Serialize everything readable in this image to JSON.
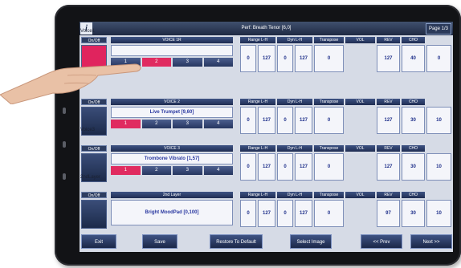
{
  "app": {
    "info_glyph": "i",
    "title": "Perf: Breath Tenor [6,0]",
    "page": "Page 1/3"
  },
  "param_headers": [
    "Range L-H",
    "Dyn L-H",
    "Transpose",
    "VOL",
    "REV",
    "CHO"
  ],
  "tab_labels": [
    "1",
    "2",
    "3",
    "4"
  ],
  "rows": [
    {
      "section_label": "Voice1",
      "onoff_label": "On/Off",
      "onoff_state": "on",
      "header": "VOICE 1R",
      "name": "",
      "has_tabs": true,
      "selected_tab": 2,
      "values": [
        "0",
        "127",
        "0",
        "127",
        "0",
        "127",
        "40",
        "0"
      ]
    },
    {
      "section_label": "",
      "onoff_label": "On/Off",
      "onoff_state": "off",
      "header": "VOICE 2",
      "name": "Live Trumpet [9,60]",
      "has_tabs": true,
      "selected_tab": 1,
      "values": [
        "0",
        "127",
        "0",
        "127",
        "0",
        "127",
        "30",
        "10"
      ]
    },
    {
      "section_label": "Voice3",
      "onoff_label": "On/Off",
      "onoff_state": "off",
      "header": "VOICE 3",
      "name": "Trombone Vibrato [1,57]",
      "has_tabs": true,
      "selected_tab": 1,
      "values": [
        "0",
        "127",
        "0",
        "127",
        "0",
        "127",
        "30",
        "10"
      ]
    },
    {
      "section_label": "2ndLayer",
      "onoff_label": "On/Off",
      "onoff_state": "off",
      "header": "2nd Layer",
      "name": "Bright MoodPad [0,100]",
      "has_tabs": false,
      "selected_tab": null,
      "values": [
        "0",
        "127",
        "0",
        "127",
        "0",
        "97",
        "30",
        "10"
      ]
    }
  ],
  "footer": {
    "exit": "Exit",
    "save": "Save",
    "restore": "Restore To Default",
    "select_image": "Select Image",
    "prev": "<< Prev",
    "next": "Next >>"
  },
  "colors": {
    "accent_pink": "#e0245e",
    "header_navy": "#2d3d60",
    "value_text": "#1e2f8a"
  },
  "icons": {
    "info": "info-icon"
  }
}
